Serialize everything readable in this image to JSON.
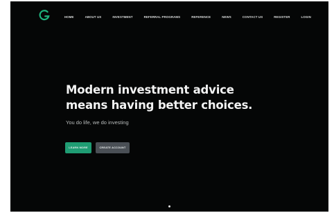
{
  "nav": {
    "items": [
      {
        "label": "HOME"
      },
      {
        "label": "ABOUT US"
      },
      {
        "label": "INVESTMENT"
      },
      {
        "label": "REFERRAL PROGRAMS"
      },
      {
        "label": "REFERENCE"
      },
      {
        "label": "NEWS"
      },
      {
        "label": "CONTACT US"
      },
      {
        "label": "REGISTER"
      },
      {
        "label": "LOGIN"
      }
    ]
  },
  "hero": {
    "headline_line1": "Modern investment advice",
    "headline_line2": "means having better choices.",
    "tagline": "You do life, we do investing",
    "primary_button": "LEARN MORE",
    "secondary_button": "CREATE ACCOUNT"
  },
  "icons": {
    "logo": "g-logo-icon",
    "scroll": "scroll-dot-icon"
  },
  "colors": {
    "background": "#050606",
    "accent": "#1f9c73",
    "secondary_button": "#4a4f55",
    "text": "#f2f2f2"
  }
}
